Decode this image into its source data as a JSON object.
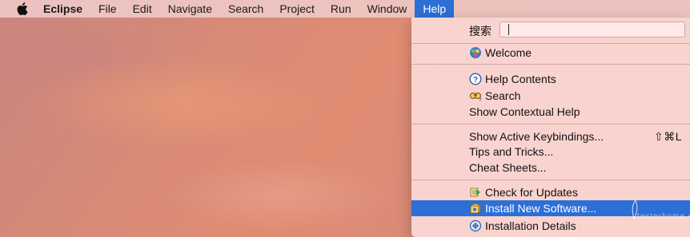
{
  "menubar": {
    "apple_icon": "apple-logo-icon",
    "app_name": "Eclipse",
    "items": [
      "File",
      "Edit",
      "Navigate",
      "Search",
      "Project",
      "Run",
      "Window",
      "Help"
    ],
    "active_item": "Help"
  },
  "help_menu": {
    "search_label": "搜索",
    "search_value": "",
    "items": [
      {
        "label": "Welcome",
        "icon": "welcome-icon"
      },
      {
        "label": "Help Contents",
        "icon": "help-question-icon"
      },
      {
        "label": "Search",
        "icon": "search-binoculars-icon"
      },
      {
        "label": "Show Contextual Help",
        "icon": ""
      },
      {
        "label": "Show Active Keybindings...",
        "shortcut": "⇧⌘L"
      },
      {
        "label": "Tips and Tricks..."
      },
      {
        "label": "Cheat Sheets..."
      },
      {
        "label": "Check for Updates",
        "icon": "update-arrows-icon"
      },
      {
        "label": "Install New Software...",
        "icon": "install-software-icon",
        "highlighted": true
      },
      {
        "label": "Installation Details",
        "icon": "installation-details-icon"
      }
    ]
  },
  "colors": {
    "highlight": "#2c6fd6",
    "menu_bg": "#fad6d2"
  },
  "watermark": "testerhome.com"
}
